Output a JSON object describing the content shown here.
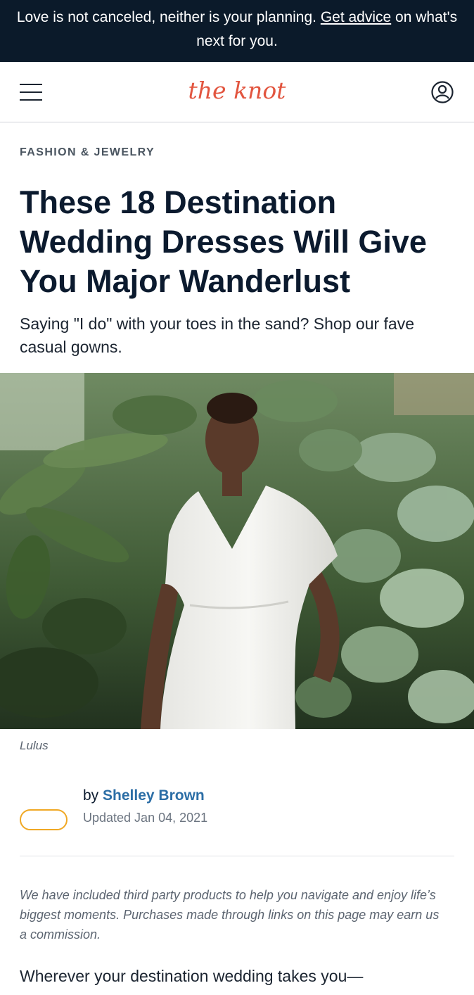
{
  "banner": {
    "text_before": "Love is not canceled, neither is your planning. ",
    "link": "Get advice",
    "text_after": " on what's next for you."
  },
  "header": {
    "logo_text": "the knot",
    "brand_color": "#e2553f",
    "menu_icon": "hamburger-menu-icon",
    "account_icon": "user-account-icon"
  },
  "article": {
    "category": "FASHION & JEWELRY",
    "title": "These 18 Destination Wedding Dresses Will Give You Major Wanderlust",
    "subtitle": "Saying \"I do\" with your toes in the sand? Shop our fave casual gowns.",
    "image_credit": "Lulus",
    "by": "by",
    "author": "Shelley Brown",
    "updated": "Updated Jan 04, 2021",
    "disclaimer": "We have included third party products to help you navigate and enjoy life’s biggest moments. Purchases made through links on this page may earn us a commission.",
    "body_start": "Wherever your destination wedding takes you—"
  },
  "colors": {
    "banner_bg": "#0b1a2a",
    "link": "#2c6ea6",
    "avatar_border": "#f0a824"
  }
}
